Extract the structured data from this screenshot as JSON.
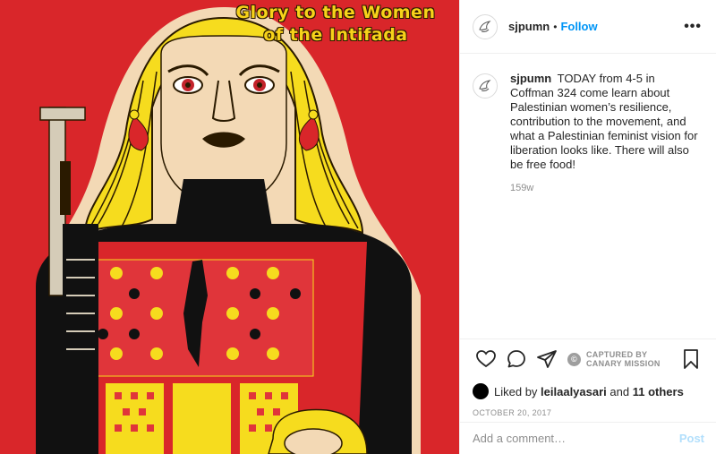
{
  "poster": {
    "title_line1": "Glory to the Women",
    "title_line2": "of the Intifada"
  },
  "header": {
    "username": "sjpumn",
    "separator": "•",
    "follow_label": "Follow",
    "more_label": "•••"
  },
  "caption": {
    "username": "sjpumn",
    "text": "TODAY from 4-5 in Coffman 324 come learn about Palestinian women’s resilience, contribution to the movement, and what a Palestinian feminist vision for liberation looks like. There will also be free food!",
    "time": "159w"
  },
  "watermark": {
    "badge": "©",
    "line1": "CAPTURED BY",
    "line2": "CANARY MISSION"
  },
  "likes": {
    "prefix": "Liked by",
    "user": "leilaalyasari",
    "and": "and",
    "others": "11 others"
  },
  "date": "OCTOBER 20, 2017",
  "comment": {
    "placeholder": "Add a comment…",
    "post_label": "Post"
  },
  "colors": {
    "background_red": "#d9262a",
    "title_yellow": "#f7d21a",
    "follow_blue": "#0095f6"
  }
}
